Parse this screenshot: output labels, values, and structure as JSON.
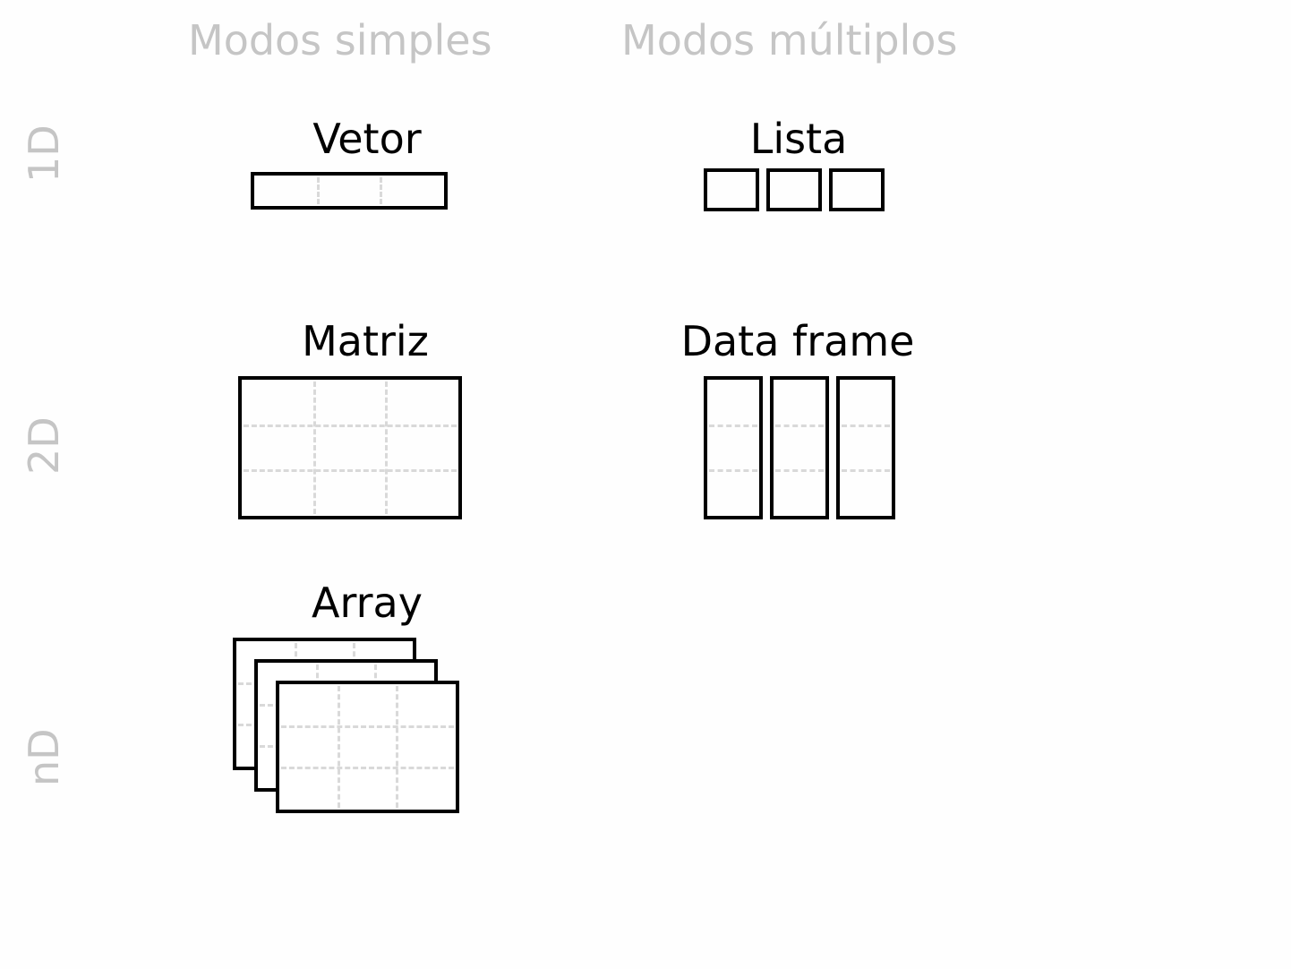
{
  "columns": {
    "simple": "Modos simples",
    "multiple": "Modos múltiplos"
  },
  "rows": {
    "one_d": "1D",
    "two_d": "2D",
    "n_d": "nD"
  },
  "cells": {
    "vector": "Vetor",
    "list": "Lista",
    "matrix": "Matriz",
    "dataframe": "Data frame",
    "array": "Array"
  }
}
